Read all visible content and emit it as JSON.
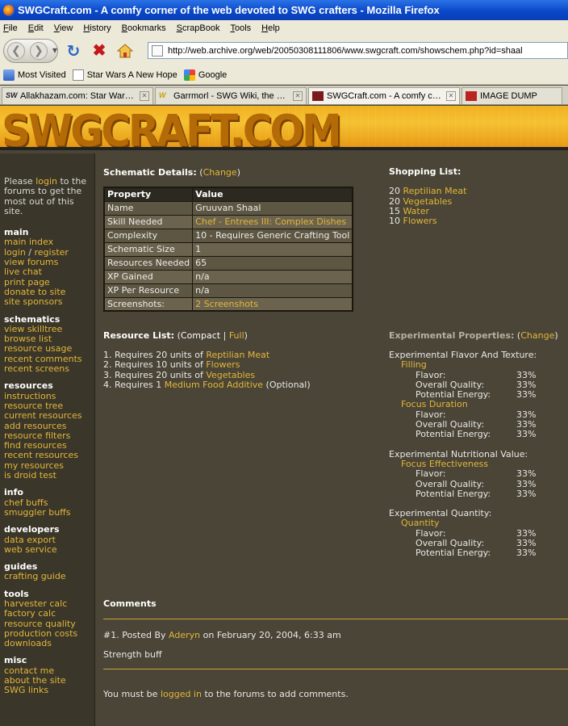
{
  "browser": {
    "window_title": "SWGCraft.com - A comfy corner of the web devoted to SWG crafters - Mozilla Firefox",
    "menu": [
      "File",
      "Edit",
      "View",
      "History",
      "Bookmarks",
      "ScrapBook",
      "Tools",
      "Help"
    ],
    "url": "http://web.archive.org/web/20050308111806/www.swgcraft.com/showschem.php?id=shaal",
    "bookmarks": [
      "Most Visited",
      "Star Wars A New Hope",
      "Google"
    ],
    "tabs": [
      {
        "label": "Allakhazam.com: Star Wars G...",
        "active": false
      },
      {
        "label": "Garrmorl - SWG Wiki, the Star...",
        "active": false
      },
      {
        "label": "SWGCraft.com - A comfy cor...",
        "active": true
      },
      {
        "label": "IMAGE DUMP",
        "active": false
      }
    ]
  },
  "site": {
    "logo": "SWGCRAFT.COM"
  },
  "sidebar": {
    "intro_pre": "Please ",
    "intro_link": "login",
    "intro_post": " to the forums to get the most out of this site.",
    "sections": [
      {
        "title": "main",
        "items": [
          "main index",
          "login / register",
          "view forums",
          "live chat",
          "print page",
          "donate to site",
          "site sponsors"
        ]
      },
      {
        "title": "schematics",
        "items": [
          "view skilltree",
          "browse list",
          "resource usage",
          "recent comments",
          "recent screens"
        ]
      },
      {
        "title": "resources",
        "items": [
          "instructions",
          "resource tree",
          "current resources",
          "add resources",
          "resource filters",
          "find resources",
          "recent resources",
          "my resources",
          "is droid test"
        ]
      },
      {
        "title": "info",
        "items": [
          "chef buffs",
          "smuggler buffs"
        ]
      },
      {
        "title": "developers",
        "items": [
          "data export",
          "web service"
        ]
      },
      {
        "title": "guides",
        "items": [
          "crafting guide"
        ]
      },
      {
        "title": "tools",
        "items": [
          "harvester calc",
          "factory calc",
          "resource quality",
          "production costs",
          "downloads"
        ]
      },
      {
        "title": "misc",
        "items": [
          "contact me",
          "about the site",
          "SWG links"
        ]
      }
    ]
  },
  "schematic": {
    "heading": "Schematic Details:",
    "change_open": "(",
    "change_link": "Change",
    "change_close": ")",
    "table_headers": [
      "Property",
      "Value"
    ],
    "rows": [
      {
        "property": "Name",
        "value": "Gruuvan Shaal",
        "is_link": false
      },
      {
        "property": "Skill Needed",
        "value": "Chef - Entrees III: Complex Dishes",
        "is_link": true
      },
      {
        "property": "Complexity",
        "value": "10 - Requires Generic Crafting Tool",
        "is_link": false
      },
      {
        "property": "Schematic Size",
        "value": "1",
        "is_link": false
      },
      {
        "property": "Resources Needed",
        "value": "65",
        "is_link": false
      },
      {
        "property": "XP Gained",
        "value": "n/a",
        "is_link": false
      },
      {
        "property": "XP Per Resource",
        "value": "n/a",
        "is_link": false
      },
      {
        "property": "Screenshots:",
        "value": "2 Screenshots",
        "is_link": true
      }
    ]
  },
  "shopping": {
    "heading": "Shopping List:",
    "items": [
      {
        "qty": "20",
        "name": "Reptilian Meat"
      },
      {
        "qty": "20",
        "name": "Vegetables"
      },
      {
        "qty": "15",
        "name": "Water"
      },
      {
        "qty": "10",
        "name": "Flowers"
      }
    ]
  },
  "resource_list": {
    "heading": "Resource List:",
    "compact": "Compact",
    "full": "Full",
    "items": [
      {
        "pre": "1. Requires 20 units of ",
        "link": "Reptilian Meat",
        "post": ""
      },
      {
        "pre": "2. Requires 10 units of ",
        "link": "Flowers",
        "post": ""
      },
      {
        "pre": "3. Requires 20 units of ",
        "link": "Vegetables",
        "post": ""
      },
      {
        "pre": "4. Requires 1 ",
        "link": "Medium Food Additive",
        "post": " (Optional)"
      }
    ]
  },
  "experimental": {
    "heading": "Experimental Properties:",
    "change_link": "Change",
    "groups": [
      {
        "title": "Experimental Flavor And Texture:",
        "subs": [
          {
            "name": "Filling",
            "rows": [
              [
                "Flavor:",
                "33%"
              ],
              [
                "Overall Quality:",
                "33%"
              ],
              [
                "Potential Energy:",
                "33%"
              ]
            ]
          },
          {
            "name": "Focus Duration",
            "rows": [
              [
                "Flavor:",
                "33%"
              ],
              [
                "Overall Quality:",
                "33%"
              ],
              [
                "Potential Energy:",
                "33%"
              ]
            ]
          }
        ]
      },
      {
        "title": "Experimental Nutritional Value:",
        "subs": [
          {
            "name": "Focus Effectiveness",
            "rows": [
              [
                "Flavor:",
                "33%"
              ],
              [
                "Overall Quality:",
                "33%"
              ],
              [
                "Potential Energy:",
                "33%"
              ]
            ]
          }
        ]
      },
      {
        "title": "Experimental Quantity:",
        "subs": [
          {
            "name": "Quantity",
            "rows": [
              [
                "Flavor:",
                "33%"
              ],
              [
                "Overall Quality:",
                "33%"
              ],
              [
                "Potential Energy:",
                "33%"
              ]
            ]
          }
        ]
      }
    ]
  },
  "comments": {
    "heading": "Comments",
    "post_prefix": "#1. Posted By ",
    "post_author": "Aderyn",
    "post_date": " on February 20, 2004, 6:33 am",
    "post_text": "Strength buff",
    "login_pre": "You must be ",
    "login_link": "logged in",
    "login_post": " to the forums to add comments."
  }
}
